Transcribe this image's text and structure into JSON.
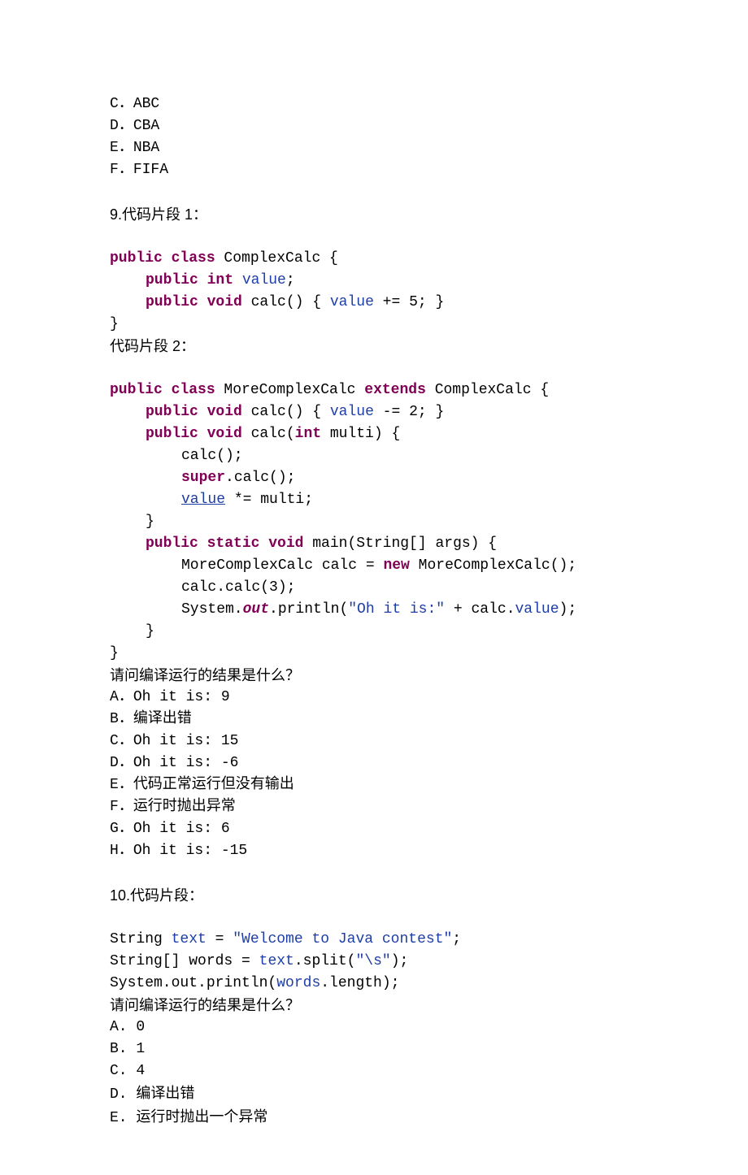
{
  "prev_options": [
    {
      "label": "C",
      "text": "ABC"
    },
    {
      "label": "D",
      "text": "CBA"
    },
    {
      "label": "E",
      "text": "NBA"
    },
    {
      "label": "F",
      "text": "FIFA"
    }
  ],
  "q9": {
    "header": "9.代码片段 1：",
    "c1": {
      "t0": "public class",
      "t1": " ComplexCalc {",
      "t2": "public int",
      "t3": " ",
      "t4": "value",
      "t5": ";",
      "t6": "public void",
      "t7": " calc() { ",
      "t8": "value",
      "t9": " += 5; }",
      "t10": "}"
    },
    "mid": "代码片段 2：",
    "c2": {
      "l0a": "public class",
      "l0b": " MoreComplexCalc ",
      "l0c": "extends",
      "l0d": " ComplexCalc {",
      "l1a": "public void",
      "l1b": " calc() { ",
      "l1c": "value",
      "l1d": " -= 2; }",
      "l2a": "public void",
      "l2b": " calc(",
      "l2c": "int",
      "l2d": " multi) {",
      "l3": "calc();",
      "l4a": "super",
      "l4b": ".calc();",
      "l5a": "value",
      "l5b": " *= multi;",
      "l6": "}",
      "l7a": "public static void",
      "l7b": " main(String[] args) {",
      "l8a": "MoreComplexCalc calc = ",
      "l8b": "new",
      "l8c": " MoreComplexCalc();",
      "l9": "calc.calc(3);",
      "l10a": "System.",
      "l10b": "out",
      "l10c": ".println(",
      "l10d": "\"Oh it is:\"",
      "l10e": " + calc.",
      "l10f": "value",
      "l10g": ");",
      "l11": "}",
      "l12": "}"
    },
    "question": "请问编译运行的结果是什么？",
    "options": [
      {
        "label": "A",
        "text": "Oh it is: 9",
        "mono": true
      },
      {
        "label": "B",
        "text": "编译出错",
        "mono": false
      },
      {
        "label": "C",
        "text": "Oh it is: 15",
        "mono": true
      },
      {
        "label": "D",
        "text": "Oh it is: -6",
        "mono": true
      },
      {
        "label": "E",
        "text": "代码正常运行但没有输出",
        "mono": false
      },
      {
        "label": "F",
        "text": "运行时抛出异常",
        "mono": false
      },
      {
        "label": "G",
        "text": "Oh it is: 6",
        "mono": true
      },
      {
        "label": "H",
        "text": "Oh it is: -15",
        "mono": true
      }
    ]
  },
  "q10": {
    "header": "10.代码片段：",
    "c": {
      "l0a": "String ",
      "l0b": "text",
      "l0c": " = ",
      "l0d": "\"Welcome to Java contest\"",
      "l0e": ";",
      "l1a": "String[] words = ",
      "l1b": "text",
      "l1c": ".split(",
      "l1d": "\"\\s\"",
      "l1e": ");",
      "l2a": "System.out.println(",
      "l2b": "words",
      "l2c": ".length);"
    },
    "question": "请问编译运行的结果是什么？",
    "options": [
      {
        "label": "A",
        "text": "0",
        "mono": true
      },
      {
        "label": "B",
        "text": "1",
        "mono": true
      },
      {
        "label": "C",
        "text": "4",
        "mono": true
      },
      {
        "label": "D",
        "text": "编译出错",
        "mono": false
      },
      {
        "label": "E",
        "text": "运行时抛出一个异常",
        "mono": false
      }
    ]
  }
}
